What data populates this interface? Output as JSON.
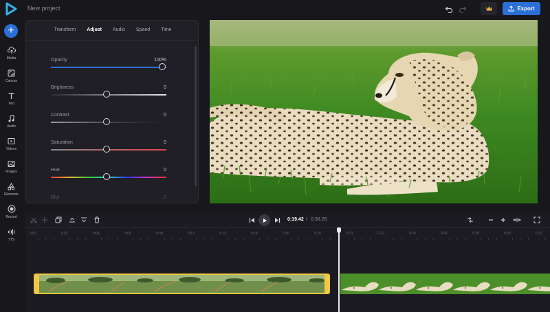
{
  "app": {
    "project_title": "New project"
  },
  "header": {
    "export_label": "Export"
  },
  "rail": [
    {
      "icon": "plus-icon",
      "label": ""
    },
    {
      "icon": "cloud-upload-icon",
      "label": "Media"
    },
    {
      "icon": "canvas-icon",
      "label": "Canvas"
    },
    {
      "icon": "text-icon",
      "label": "Text"
    },
    {
      "icon": "music-note-icon",
      "label": "Audio"
    },
    {
      "icon": "video-icon",
      "label": "Videos"
    },
    {
      "icon": "image-icon",
      "label": "Images"
    },
    {
      "icon": "shapes-icon",
      "label": "Elements"
    },
    {
      "icon": "record-icon",
      "label": "Record"
    },
    {
      "icon": "waveform-icon",
      "label": "TTS"
    }
  ],
  "panel": {
    "tabs": [
      "Transform",
      "Adjust",
      "Audio",
      "Speed",
      "Time"
    ],
    "active_tab": "Adjust",
    "sliders": [
      {
        "label": "Opacity",
        "value": "100%",
        "level": 1.0
      },
      {
        "label": "Brightness",
        "value": "0",
        "level": 0.5
      },
      {
        "label": "Contrast",
        "value": "0",
        "level": 0.5
      },
      {
        "label": "Saturation",
        "value": "0",
        "level": 0.5
      },
      {
        "label": "Hue",
        "value": "0",
        "level": 0.5
      },
      {
        "label": "Blur",
        "value": "0",
        "level": 0.0
      }
    ]
  },
  "timeline": {
    "current_time": "0:19.42",
    "separator": "/",
    "total_time": "0:38.26",
    "ruler_ticks": [
      "0:00",
      "0:02",
      "0:04",
      "0:06",
      "0:08",
      "0:10",
      "0:12",
      "0:14",
      "0:16",
      "0:18",
      "0:20",
      "0:22",
      "0:24",
      "0:26",
      "0:28",
      "0:30",
      "0:32"
    ]
  },
  "colors": {
    "accent": "#2b6fd6",
    "clip_selected_border": "#f2c744",
    "background": "#17171c",
    "panel": "#1f1f25"
  }
}
